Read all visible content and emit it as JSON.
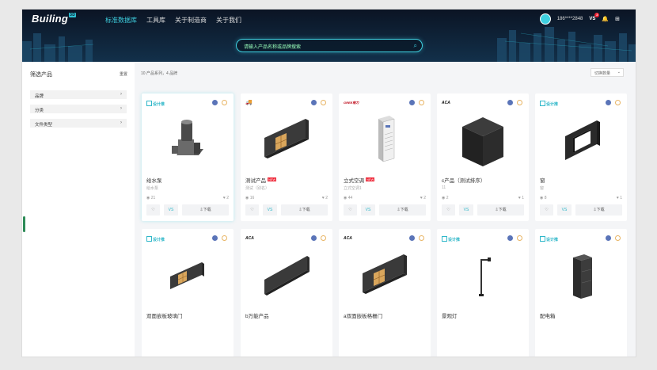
{
  "header": {
    "logo": "Builing",
    "logo_badge": "3D",
    "nav": [
      "标准数据库",
      "工具库",
      "关于制造商",
      "关于我们"
    ],
    "user_phone": "186****2848",
    "vs_label": "VS",
    "vs_badge": "2",
    "search_placeholder": "请输入产品名称或品牌搜索"
  },
  "sidebar": {
    "title": "筛选产品",
    "reset": "重置",
    "filters": [
      {
        "label": "品牌"
      },
      {
        "label": "分类"
      },
      {
        "label": "文件类型"
      }
    ]
  },
  "main": {
    "count_text": "10 产品系列，4 品牌",
    "sort_label": "切换数量",
    "like_label": "♡",
    "vs_label": "VS",
    "download_label": "⇩下载",
    "cards": [
      {
        "brand": "设计推",
        "brand_type": "sj",
        "name": "给水泵",
        "tag": "",
        "sub": "给水泵",
        "views": "21",
        "likes": "2",
        "thumb": "pump",
        "highlight": true
      },
      {
        "brand": "🚚",
        "brand_type": "truck",
        "name": "测试产品",
        "tag": "NEW",
        "sub": "测试（别名）",
        "views": "16",
        "likes": "2",
        "thumb": "doorwall",
        "highlight": false
      },
      {
        "brand": "GREE格力",
        "brand_type": "gree",
        "name": "立式空调",
        "tag": "NEW",
        "sub": "立式空调1",
        "views": "44",
        "likes": "2",
        "thumb": "ac",
        "highlight": false
      },
      {
        "brand": "ACA",
        "brand_type": "aca",
        "name": "c产品（测试排序）",
        "tag": "",
        "sub": "11",
        "views": "2",
        "likes": "1",
        "thumb": "box",
        "highlight": false
      },
      {
        "brand": "设计推",
        "brand_type": "sj",
        "name": "窗",
        "tag": "",
        "sub": "窗",
        "views": "8",
        "likes": "1",
        "thumb": "window",
        "highlight": false
      },
      {
        "brand": "设计推",
        "brand_type": "sj",
        "name": "双面嵌板玻璃门",
        "tag": "",
        "sub": "",
        "views": "",
        "likes": "",
        "thumb": "doorwall-small",
        "highlight": false
      },
      {
        "brand": "ACA",
        "brand_type": "aca",
        "name": "b万能产品",
        "tag": "",
        "sub": "",
        "views": "",
        "likes": "",
        "thumb": "wall",
        "highlight": false
      },
      {
        "brand": "ACA",
        "brand_type": "aca",
        "name": "a双面嵌板格栅门",
        "tag": "",
        "sub": "",
        "views": "",
        "likes": "",
        "thumb": "doorwall",
        "highlight": false
      },
      {
        "brand": "设计推",
        "brand_type": "sj",
        "name": "景观灯",
        "tag": "",
        "sub": "",
        "views": "",
        "likes": "",
        "thumb": "lamp",
        "highlight": false
      },
      {
        "brand": "设计推",
        "brand_type": "sj",
        "name": "配电箱",
        "tag": "",
        "sub": "",
        "views": "",
        "likes": "",
        "thumb": "cabinet",
        "highlight": false
      }
    ]
  }
}
